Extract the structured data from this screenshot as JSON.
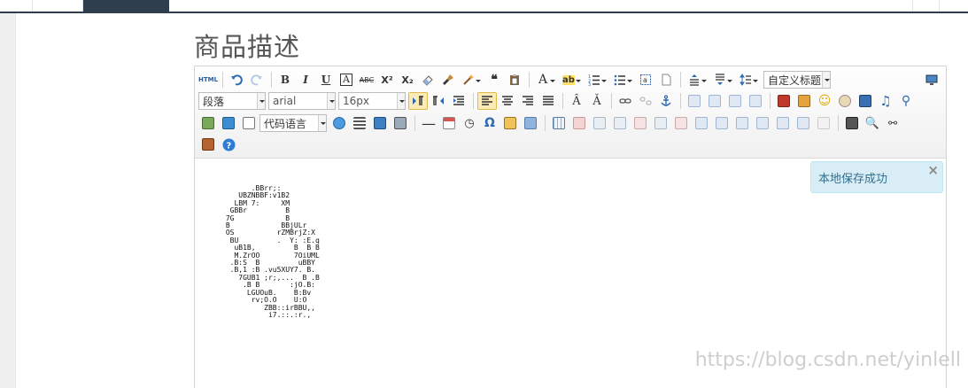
{
  "page": {
    "title": "商品描述"
  },
  "toolbar": {
    "row1": [
      {
        "name": "html-source-button",
        "label": "HTML"
      },
      {
        "name": "undo-button",
        "icon": "undo-icon"
      },
      {
        "name": "redo-button",
        "icon": "redo-icon"
      },
      {
        "name": "bold-button",
        "label": "B"
      },
      {
        "name": "italic-button",
        "label": "I"
      },
      {
        "name": "underline-button",
        "label": "U"
      },
      {
        "name": "font-border-button",
        "label": "A"
      },
      {
        "name": "strikethrough-button",
        "label": "ABC"
      },
      {
        "name": "superscript-button",
        "label": "X²"
      },
      {
        "name": "subscript-button",
        "label": "X₂"
      },
      {
        "name": "eraser-button",
        "icon": "eraser-icon"
      },
      {
        "name": "format-painter-button",
        "icon": "brush-icon"
      },
      {
        "name": "auto-typeset-button",
        "icon": "magic-wand-icon"
      },
      {
        "name": "blockquote-button",
        "label": "66"
      },
      {
        "name": "paste-plain-button",
        "icon": "paste-text-icon"
      },
      {
        "name": "font-color-button",
        "label": "A"
      },
      {
        "name": "background-color-button",
        "label": "ab"
      },
      {
        "name": "ordered-list-button",
        "icon": "ordered-list-icon"
      },
      {
        "name": "unordered-list-button",
        "icon": "unordered-list-icon"
      },
      {
        "name": "select-all-button",
        "icon": "select-all-icon"
      },
      {
        "name": "clear-doc-button",
        "icon": "clear-doc-icon"
      },
      {
        "name": "row-spacing-top-button",
        "icon": "spacing-top-icon"
      },
      {
        "name": "row-spacing-bottom-button",
        "icon": "spacing-bottom-icon"
      },
      {
        "name": "line-height-button",
        "icon": "line-height-icon"
      }
    ],
    "custom_style_label": "自定义标题",
    "paragraph_label": "段落",
    "font_family_label": "arial",
    "font_size_label": "16px",
    "code_language_label": "代码语言"
  },
  "notice": {
    "text": "本地保存成功",
    "close_label": "×"
  },
  "editor": {
    "content_lines": [
      "       .BBrr;:",
      "    UBZNBBF:v1B2",
      "   LBM 7:     XM",
      "  GBBr         B",
      " 7G            B",
      " B            BBjULr",
      " OS          rZMBrjZ:X",
      "  BU         .  Y: :E.q",
      "   uB1B,         B  B B",
      "   M.ZrOO        7OiUML",
      "  .B:S  B         uBBY",
      "  .B,1 :B .vu5XUY7. B.",
      "    7GUB1 ;r;,...  B .B",
      "     .B B       :jO.B:",
      "      LGUOuB.    B:Bv",
      "       rv;O.O    U:O",
      "          ZBB::irBBU,,",
      "           i7.::.:r.,"
    ]
  },
  "watermark": {
    "text": "https://blog.csdn.net/yinlell"
  },
  "colors": {
    "topbar_active": "#2f3e4e",
    "notice_bg": "#d9edf7",
    "notice_text": "#31708f",
    "selected_button": "#fcebb6"
  }
}
